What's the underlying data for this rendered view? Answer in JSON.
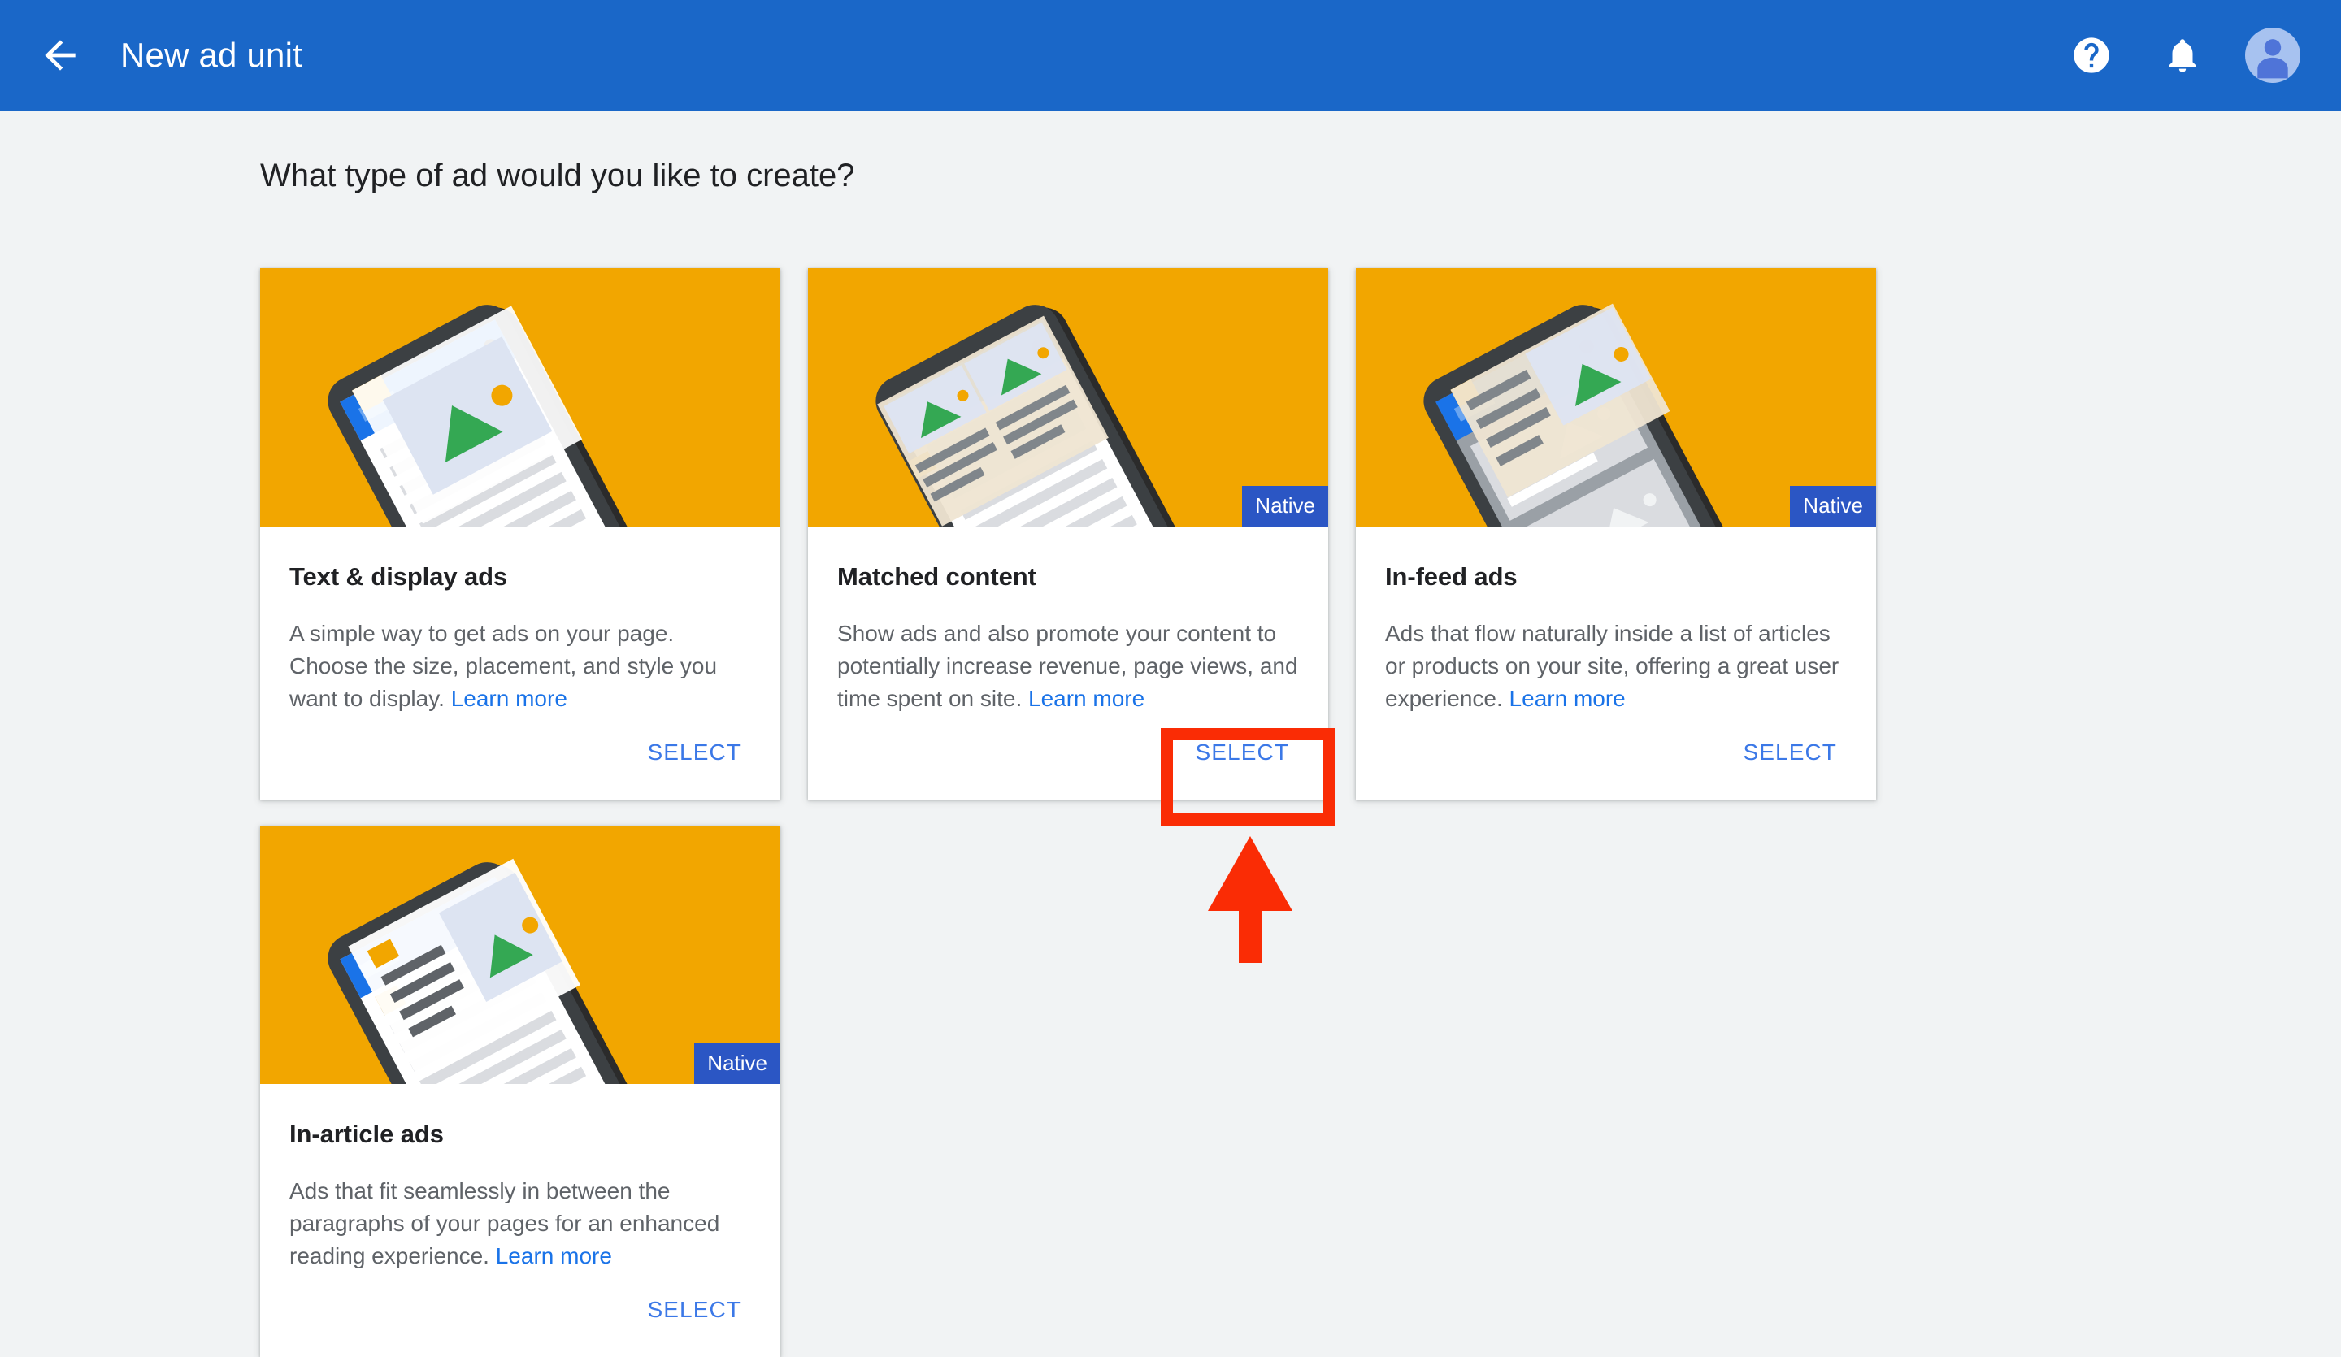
{
  "appbar": {
    "back_icon": "arrow-back-icon",
    "title": "New ad unit",
    "help_icon": "help-icon",
    "notifications_icon": "bell-icon",
    "avatar_icon": "account-avatar",
    "background_color": "#1a67c8"
  },
  "page": {
    "heading": "What type of ad would you like to create?",
    "background_color": "#f1f3f4"
  },
  "cards": [
    {
      "id": "text-display-ads",
      "title": "Text & display ads",
      "description": "A simple way to get ads on your page. Choose the size, placement, and style you want to display. ",
      "learn_more": "Learn more",
      "select_label": "SELECT",
      "badge": null,
      "media_color": "#f2a600",
      "illustration": "phone-article-with-ad-card"
    },
    {
      "id": "matched-content",
      "title": "Matched content",
      "description": "Show ads and also promote your content to potentially increase revenue, page views, and time spent on site. ",
      "learn_more": "Learn more",
      "select_label": "SELECT",
      "badge": "Native",
      "media_color": "#f2a600",
      "illustration": "phone-article-with-recommendation-grid"
    },
    {
      "id": "in-feed-ads",
      "title": "In-feed ads",
      "description": "Ads that flow naturally inside a list of articles or products on your site, offering a great user experience. ",
      "learn_more": "Learn more",
      "select_label": "SELECT",
      "badge": "Native",
      "media_color": "#f2a600",
      "illustration": "phone-feed-with-inline-ad"
    },
    {
      "id": "in-article-ads",
      "title": "In-article ads",
      "description": "Ads that fit seamlessly in between the paragraphs of your pages for an enhanced reading experience. ",
      "learn_more": "Learn more",
      "select_label": "SELECT",
      "badge": "Native",
      "media_color": "#f2a600",
      "illustration": "phone-article-with-inline-ad"
    }
  ],
  "annotation": {
    "color": "#fa2c05",
    "highlight_target": "matched-content-select-button",
    "arrow": "up-arrow-pointer"
  },
  "colors": {
    "accent_blue": "#1a73e8",
    "link_blue": "#3b78e7",
    "badge_blue": "#2b56c4",
    "orange": "#f2a600",
    "text_primary": "#202124",
    "text_secondary": "#5f6368",
    "annotation_red": "#fa2c05"
  }
}
